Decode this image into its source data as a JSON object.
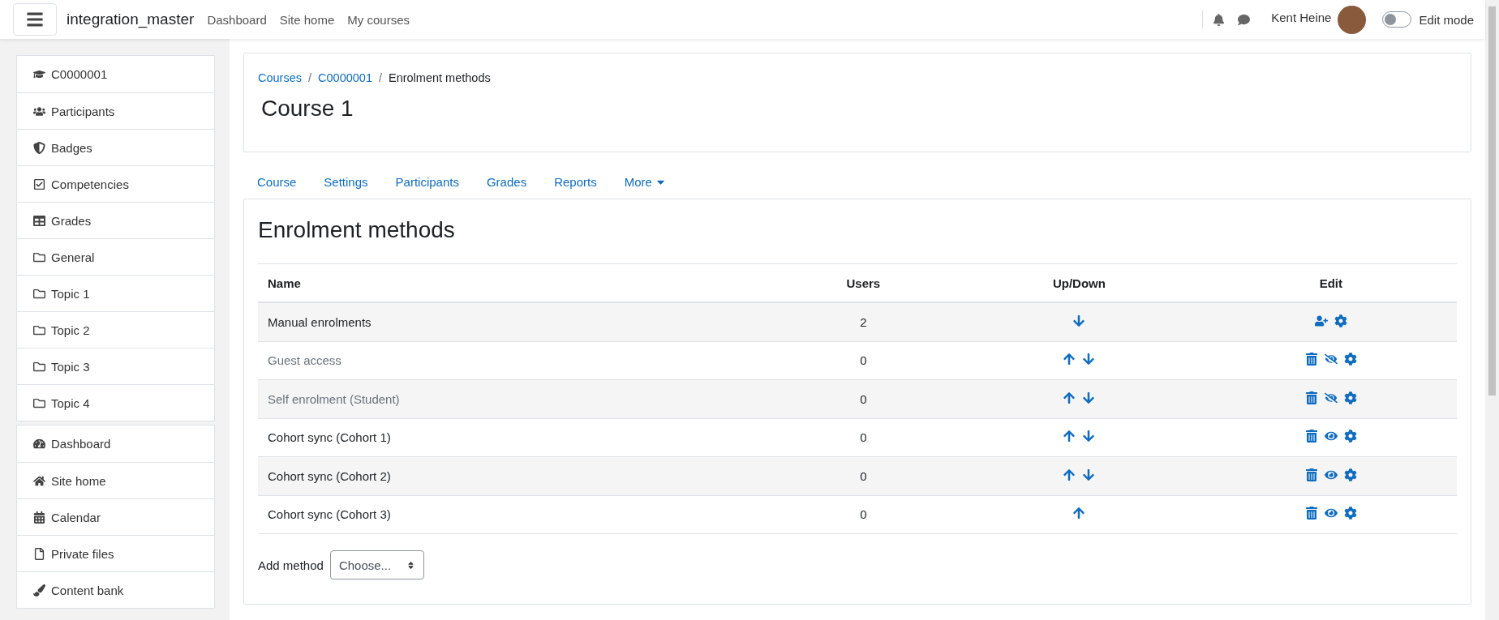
{
  "navbar": {
    "site_name": "integration_master",
    "links": [
      "Dashboard",
      "Site home",
      "My courses"
    ],
    "user_name": "Kent Heine",
    "edit_mode": {
      "label": "Edit mode",
      "on": false
    }
  },
  "sidebar": {
    "groups": [
      [
        {
          "kind": "course",
          "label": "C0000001"
        },
        {
          "kind": "participants",
          "label": "Participants"
        },
        {
          "kind": "badges",
          "label": "Badges"
        },
        {
          "kind": "competencies",
          "label": "Competencies"
        },
        {
          "kind": "grades",
          "label": "Grades"
        },
        {
          "kind": "section",
          "label": "General"
        },
        {
          "kind": "section",
          "label": "Topic 1"
        },
        {
          "kind": "section",
          "label": "Topic 2"
        },
        {
          "kind": "section",
          "label": "Topic 3"
        },
        {
          "kind": "section",
          "label": "Topic 4"
        }
      ],
      [
        {
          "kind": "dashboard",
          "label": "Dashboard"
        },
        {
          "kind": "home",
          "label": "Site home"
        },
        {
          "kind": "calendar",
          "label": "Calendar"
        },
        {
          "kind": "file",
          "label": "Private files"
        },
        {
          "kind": "brush",
          "label": "Content bank"
        }
      ]
    ]
  },
  "breadcrumb": [
    {
      "label": "Courses",
      "link": true
    },
    {
      "separator": "/"
    },
    {
      "label": "C0000001",
      "link": true
    },
    {
      "separator": "/"
    },
    {
      "label": "Enrolment methods",
      "link": false
    }
  ],
  "page_title": "Course 1",
  "tabs": [
    {
      "label": "Course",
      "selected": false
    },
    {
      "label": "Settings",
      "selected": false
    },
    {
      "label": "Participants",
      "selected": false
    },
    {
      "label": "Grades",
      "selected": false
    },
    {
      "label": "Reports",
      "selected": false
    },
    {
      "label": "More",
      "selected": false,
      "dropdown": true
    }
  ],
  "section_title": "Enrolment methods",
  "table": {
    "columns": [
      "Name",
      "Users",
      "Up/Down",
      "Edit"
    ],
    "rows": [
      {
        "kind": "manual",
        "name": "Manual enrolments",
        "users": "2",
        "up": false,
        "down": true,
        "enabled": true
      },
      {
        "kind": "plugin",
        "name": "Guest access",
        "users": "0",
        "up": true,
        "down": true,
        "enabled": false
      },
      {
        "kind": "plugin",
        "name": "Self enrolment (Student)",
        "users": "0",
        "up": true,
        "down": true,
        "enabled": false
      },
      {
        "kind": "plugin",
        "name": "Cohort sync (Cohort 1)",
        "users": "0",
        "up": true,
        "down": true,
        "enabled": true
      },
      {
        "kind": "plugin",
        "name": "Cohort sync (Cohort 2)",
        "users": "0",
        "up": true,
        "down": true,
        "enabled": true
      },
      {
        "kind": "plugin",
        "name": "Cohort sync (Cohort 3)",
        "users": "0",
        "up": true,
        "down": false,
        "enabled": true
      }
    ]
  },
  "add_method": {
    "label": "Add method",
    "value": "Choose..."
  }
}
